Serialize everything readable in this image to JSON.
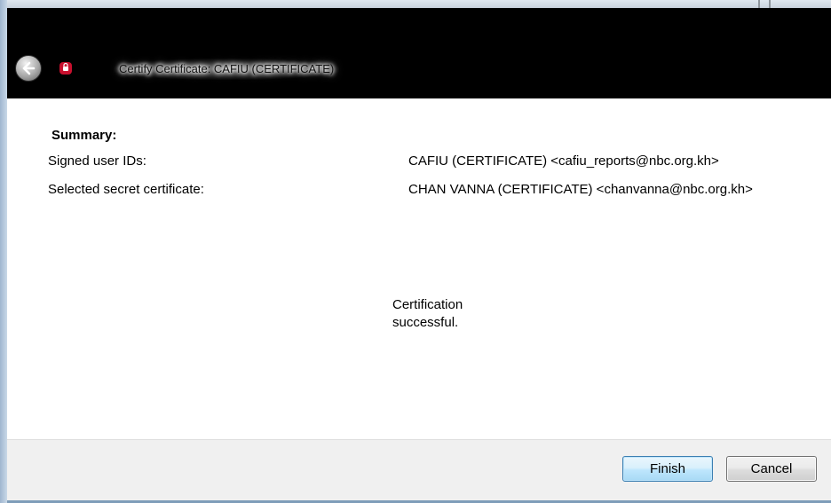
{
  "window": {
    "title": "Certify Certificate: CAFIU (CERTIFICATE)"
  },
  "summary": {
    "heading": "Summary:",
    "rows": [
      {
        "label": "Signed user IDs:",
        "value": "CAFIU (CERTIFICATE) <cafiu_reports@nbc.org.kh>"
      },
      {
        "label": "Selected secret certificate:",
        "value": "CHAN VANNA (CERTIFICATE) <chanvanna@nbc.org.kh>"
      }
    ]
  },
  "status": {
    "message": "Certification successful."
  },
  "buttons": {
    "finish": "Finish",
    "cancel": "Cancel"
  },
  "icons": {
    "back": "back-arrow-icon",
    "app": "certificate-app-icon"
  },
  "colors": {
    "titlebar_bg": "#000000",
    "footer_bg": "#f0f0f0",
    "app_icon_red": "#c8102e",
    "finish_border": "#3c7fb1"
  }
}
